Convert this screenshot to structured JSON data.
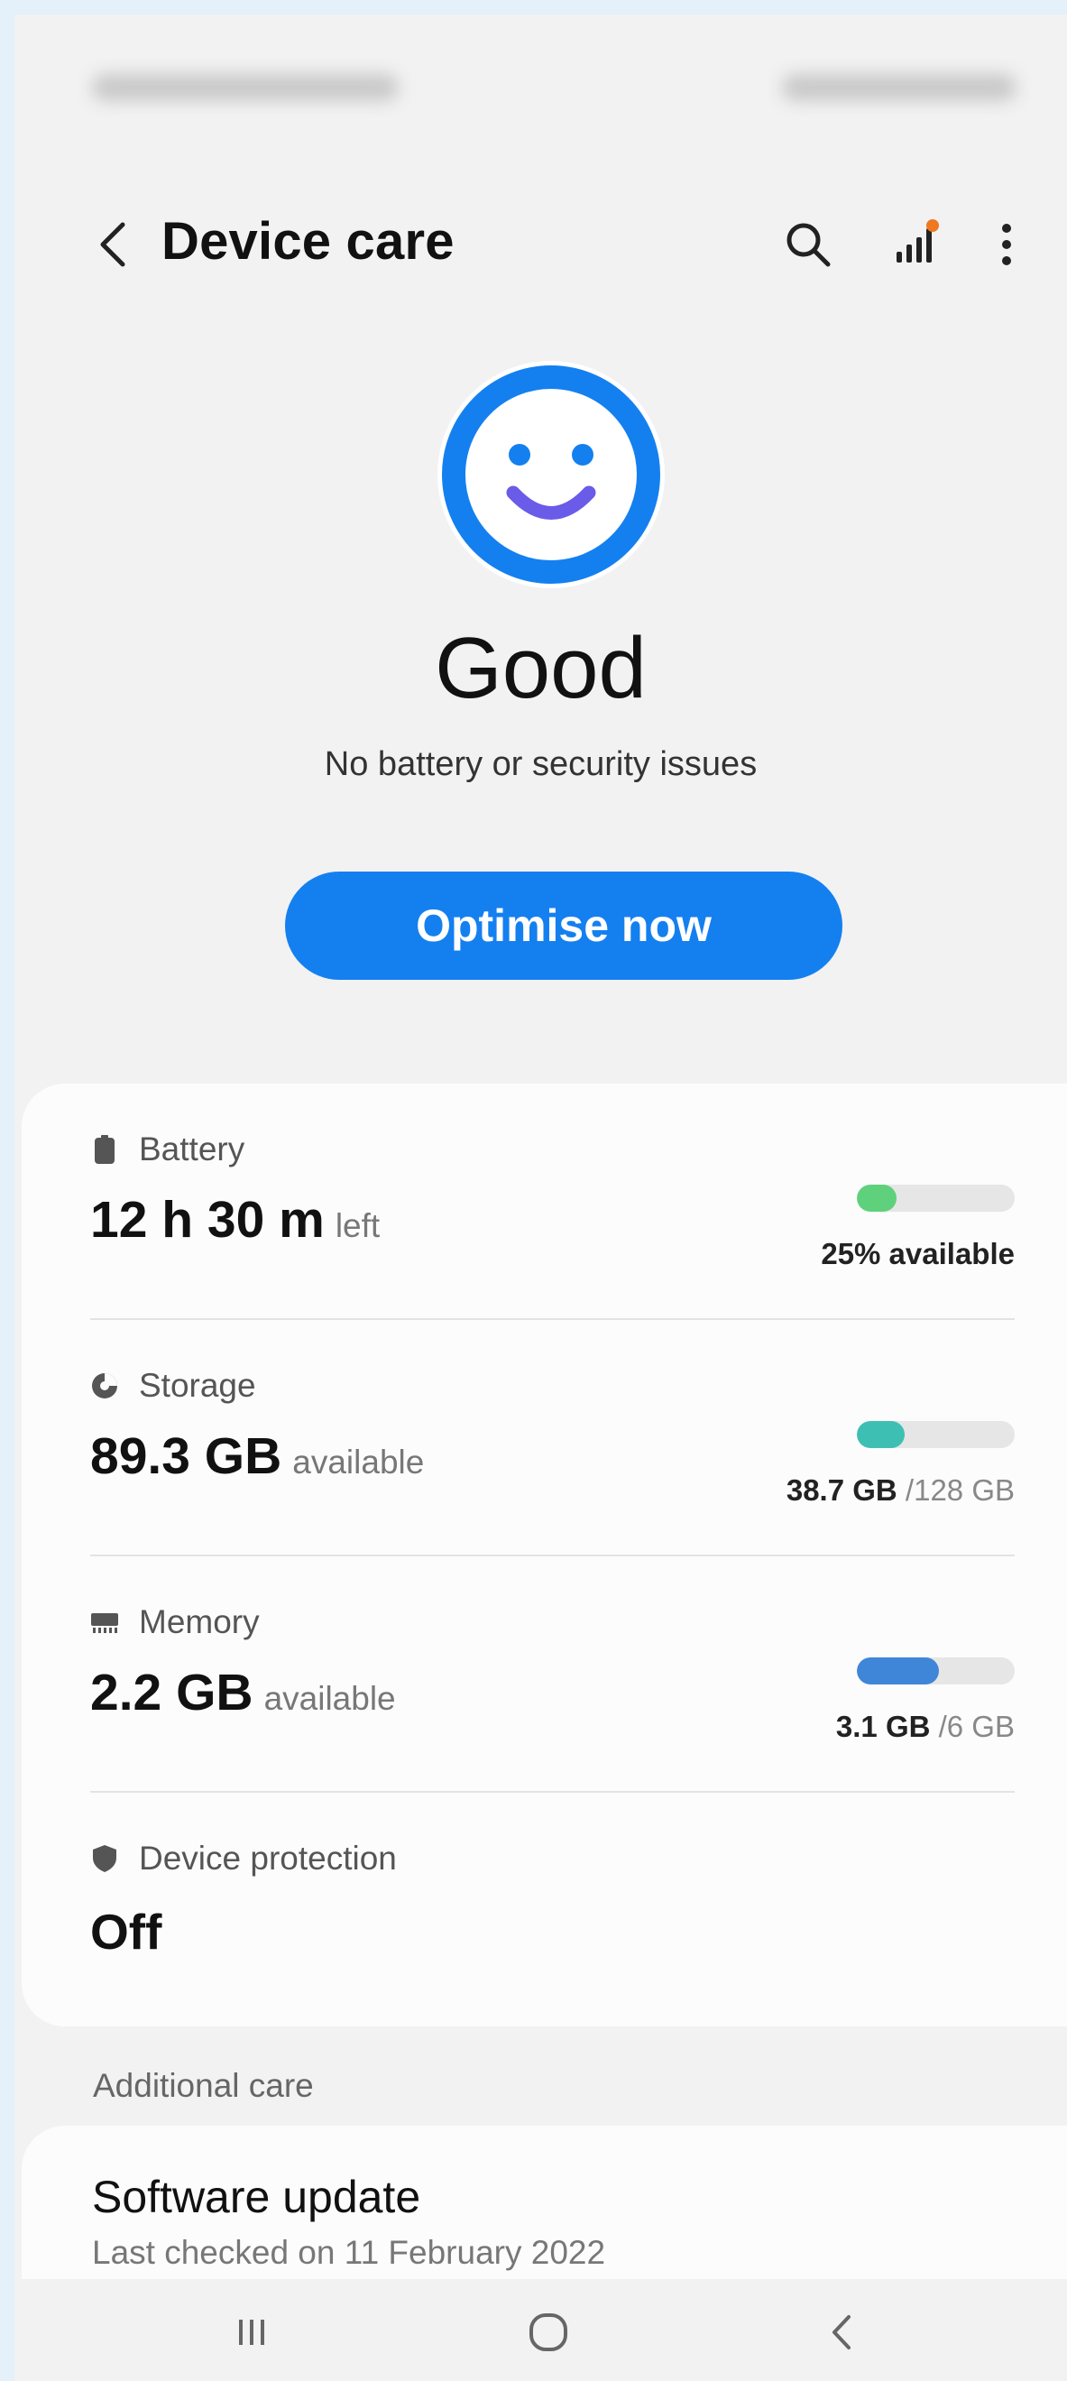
{
  "header": {
    "title": "Device care"
  },
  "status": {
    "title": "Good",
    "subtitle": "No battery or security issues",
    "action_label": "Optimise now",
    "icon": "smiley-face-icon",
    "ring_color": "#1480f0",
    "smile_color": "#6a5be8"
  },
  "rows": [
    {
      "label": "Battery",
      "icon": "battery-icon",
      "value": "12 h 30 m",
      "unit": "left",
      "right_strong": "25% available",
      "right_rest": "",
      "bar_fraction": 0.25,
      "bar_color": "#5fd17c"
    },
    {
      "label": "Storage",
      "icon": "pie-chart-icon",
      "value": "89.3 GB",
      "unit": "available",
      "right_strong": "38.7 GB",
      "right_rest": " /128 GB",
      "bar_fraction": 0.3,
      "bar_color": "#3ebfb4"
    },
    {
      "label": "Memory",
      "icon": "memory-chip-icon",
      "value": "2.2 GB",
      "unit": "available",
      "right_strong": "3.1 GB",
      "right_rest": " /6 GB",
      "bar_fraction": 0.52,
      "bar_color": "#3f86d8"
    },
    {
      "label": "Device protection",
      "icon": "shield-icon",
      "value": "Off"
    }
  ],
  "additional": {
    "section_label": "Additional care",
    "software_update_title": "Software update",
    "software_update_sub": "Last checked on 11 February 2022"
  },
  "navbar": {
    "recents_icon": "recents-icon",
    "home_icon": "home-icon",
    "back_icon": "back-icon"
  }
}
